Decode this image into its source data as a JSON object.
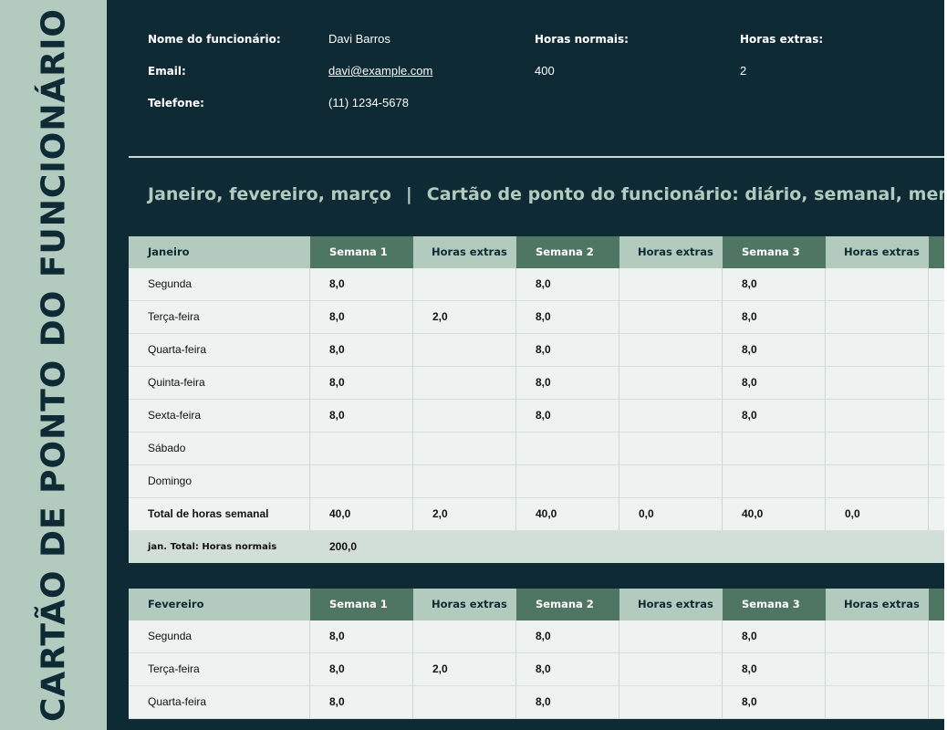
{
  "side_title": "CARTÃO DE PONTO DO FUNCIONÁRIO",
  "header": {
    "employee_label": "Nome do funcionário:",
    "employee_value": "Davi Barros",
    "email_label": "Email:",
    "email_value": "davi@example.com",
    "phone_label": "Telefone:",
    "phone_value": "(11) 1234-5678",
    "normal_hours_label": "Horas normais:",
    "normal_hours_value": "400",
    "extra_hours_label": "Horas extras:",
    "extra_hours_value": "2"
  },
  "section": {
    "months": "Janeiro, fevereiro, março",
    "separator": "|",
    "title": "Cartão de ponto do funcionário: diário, semanal, men"
  },
  "col_week1": "Semana 1",
  "col_week2": "Semana 2",
  "col_week3": "Semana 3",
  "col_extra": "Horas extras",
  "january": {
    "month": "Janeiro",
    "rows": [
      {
        "day": "Segunda",
        "w1": "8,0",
        "e1": "",
        "w2": "8,0",
        "e2": "",
        "w3": "8,0",
        "e3": ""
      },
      {
        "day": "Terça-feira",
        "w1": "8,0",
        "e1": "2,0",
        "w2": "8,0",
        "e2": "",
        "w3": "8,0",
        "e3": ""
      },
      {
        "day": "Quarta-feira",
        "w1": "8,0",
        "e1": "",
        "w2": "8,0",
        "e2": "",
        "w3": "8,0",
        "e3": ""
      },
      {
        "day": "Quinta-feira",
        "w1": "8,0",
        "e1": "",
        "w2": "8,0",
        "e2": "",
        "w3": "8,0",
        "e3": ""
      },
      {
        "day": "Sexta-feira",
        "w1": "8,0",
        "e1": "",
        "w2": "8,0",
        "e2": "",
        "w3": "8,0",
        "e3": ""
      },
      {
        "day": "Sábado",
        "w1": "",
        "e1": "",
        "w2": "",
        "e2": "",
        "w3": "",
        "e3": ""
      },
      {
        "day": "Domingo",
        "w1": "",
        "e1": "",
        "w2": "",
        "e2": "",
        "w3": "",
        "e3": ""
      }
    ],
    "total": {
      "day": "Total de horas semanal",
      "w1": "40,0",
      "e1": "2,0",
      "w2": "40,0",
      "e2": "0,0",
      "w3": "40,0",
      "e3": "0,0"
    },
    "month_total_label": "jan. Total: Horas normais",
    "month_total_value": "200,0"
  },
  "february": {
    "month": "Fevereiro",
    "rows": [
      {
        "day": "Segunda",
        "w1": "8,0",
        "e1": "",
        "w2": "8,0",
        "e2": "",
        "w3": "8,0",
        "e3": ""
      },
      {
        "day": "Terça-feira",
        "w1": "8,0",
        "e1": "2,0",
        "w2": "8,0",
        "e2": "",
        "w3": "8,0",
        "e3": ""
      },
      {
        "day": "Quarta-feira",
        "w1": "8,0",
        "e1": "",
        "w2": "8,0",
        "e2": "",
        "w3": "8,0",
        "e3": ""
      }
    ]
  }
}
